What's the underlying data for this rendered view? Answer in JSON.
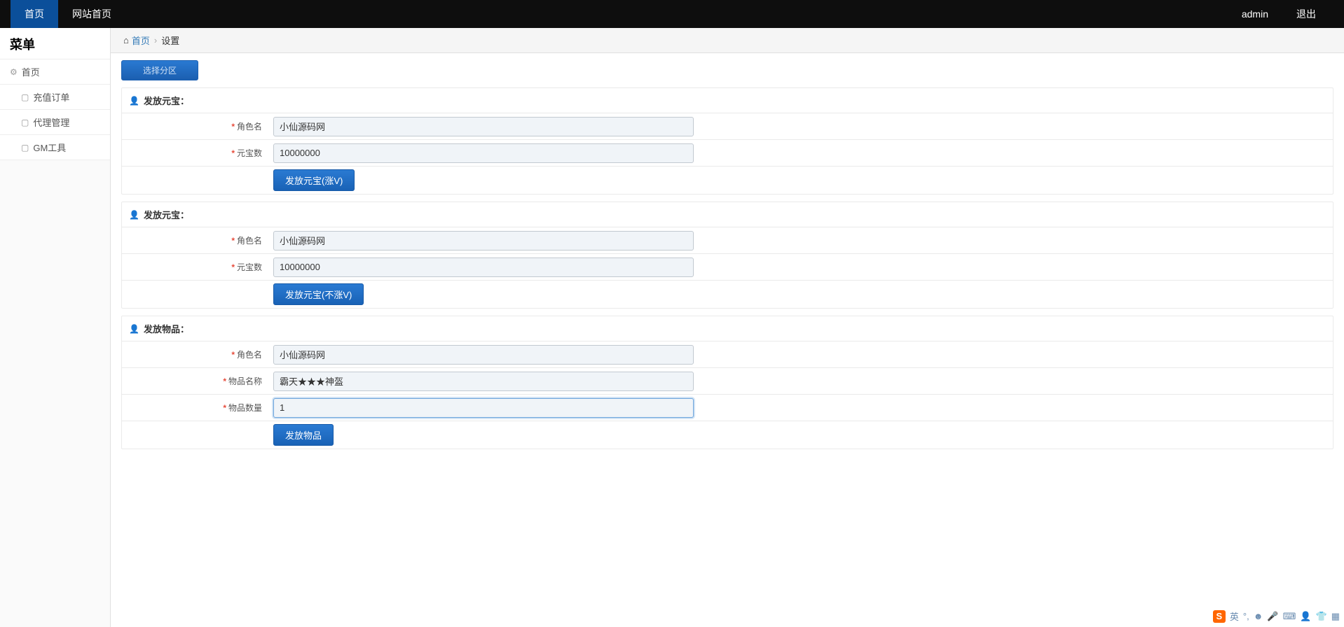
{
  "topnav": {
    "home": "首页",
    "site_home": "网站首页",
    "user": "admin",
    "logout": "退出"
  },
  "sidebar": {
    "title": "菜单",
    "home": "首页",
    "items": [
      "充值订单",
      "代理管理",
      "GM工具"
    ]
  },
  "breadcrumb": {
    "home": "首页",
    "current": "设置"
  },
  "select_zone": "选择分区",
  "sections": [
    {
      "title": "发放元宝：",
      "rows": [
        {
          "label": "角色名",
          "value": "小仙源码网"
        },
        {
          "label": "元宝数",
          "value": "10000000"
        }
      ],
      "button": "发放元宝(涨V)"
    },
    {
      "title": "发放元宝：",
      "rows": [
        {
          "label": "角色名",
          "value": "小仙源码网"
        },
        {
          "label": "元宝数",
          "value": "10000000"
        }
      ],
      "button": "发放元宝(不涨V)"
    },
    {
      "title": "发放物品：",
      "rows": [
        {
          "label": "角色名",
          "value": "小仙源码网"
        },
        {
          "label": "物品名称",
          "value": "霸天★★★神盔"
        },
        {
          "label": "物品数量",
          "value": "1",
          "focused": true
        }
      ],
      "button": "发放物品"
    }
  ],
  "ime": {
    "lang": "英"
  }
}
